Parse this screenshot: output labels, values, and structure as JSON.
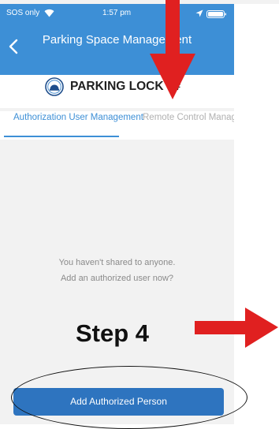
{
  "status_bar": {
    "carrier": "SOS only",
    "time": "1:57 pm",
    "icons": [
      "wifi-icon",
      "location-icon",
      "battery-icon"
    ]
  },
  "nav": {
    "back_icon": "chevron-left-icon",
    "title": "Parking Space Management"
  },
  "device": {
    "icon": "parking-lock-icon",
    "name": "PARKING LOCK 0#"
  },
  "tabs": [
    {
      "label": "Authorization User Management",
      "active": true
    },
    {
      "label": "Remote Control Management",
      "active": false
    }
  ],
  "empty_state": {
    "line1": "You haven't shared to anyone.",
    "line2": "Add an authorized user now?"
  },
  "actions": {
    "add_authorized_label": "Add Authorized Person"
  },
  "annotations": {
    "step_label": "Step 4",
    "arrow_color": "#e02020"
  },
  "colors": {
    "header": "#3d8fd6",
    "primary_button": "#2e74bf",
    "tab_active": "#3d8fd6",
    "tab_inactive": "#b0b0b0",
    "background": "#f2f2f2"
  }
}
